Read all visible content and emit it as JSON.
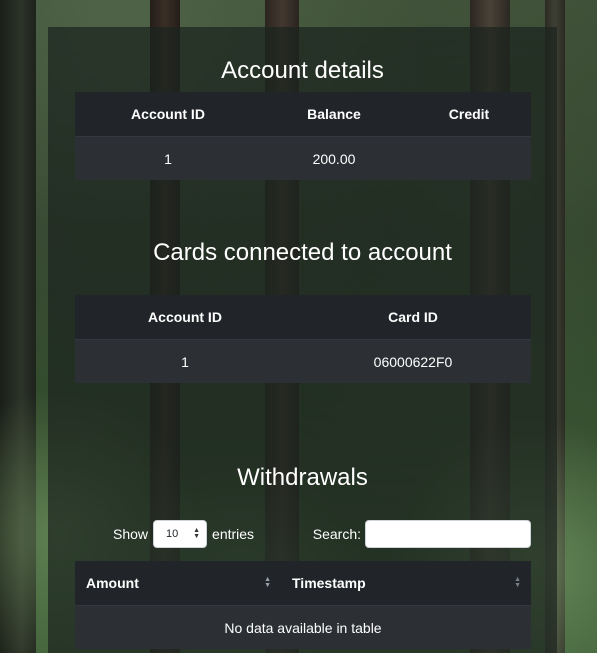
{
  "account_section": {
    "title": "Account details",
    "headers": [
      "Account ID",
      "Balance",
      "Credit"
    ],
    "row": [
      "1",
      "200.00",
      ""
    ]
  },
  "cards_section": {
    "title": "Cards connected to account",
    "headers": [
      "Account ID",
      "Card ID"
    ],
    "row": [
      "1",
      "06000622F0"
    ]
  },
  "withdrawals_section": {
    "title": "Withdrawals",
    "show_label": "Show",
    "entries_value": "10",
    "entries_label": "entries",
    "search_label": "Search:",
    "search_value": "",
    "headers": [
      "Amount",
      "Timestamp"
    ],
    "empty_message": "No data available in table"
  },
  "icons": {
    "sort": "sort-icon",
    "select_arrows": "chevron-up-down-icon"
  }
}
